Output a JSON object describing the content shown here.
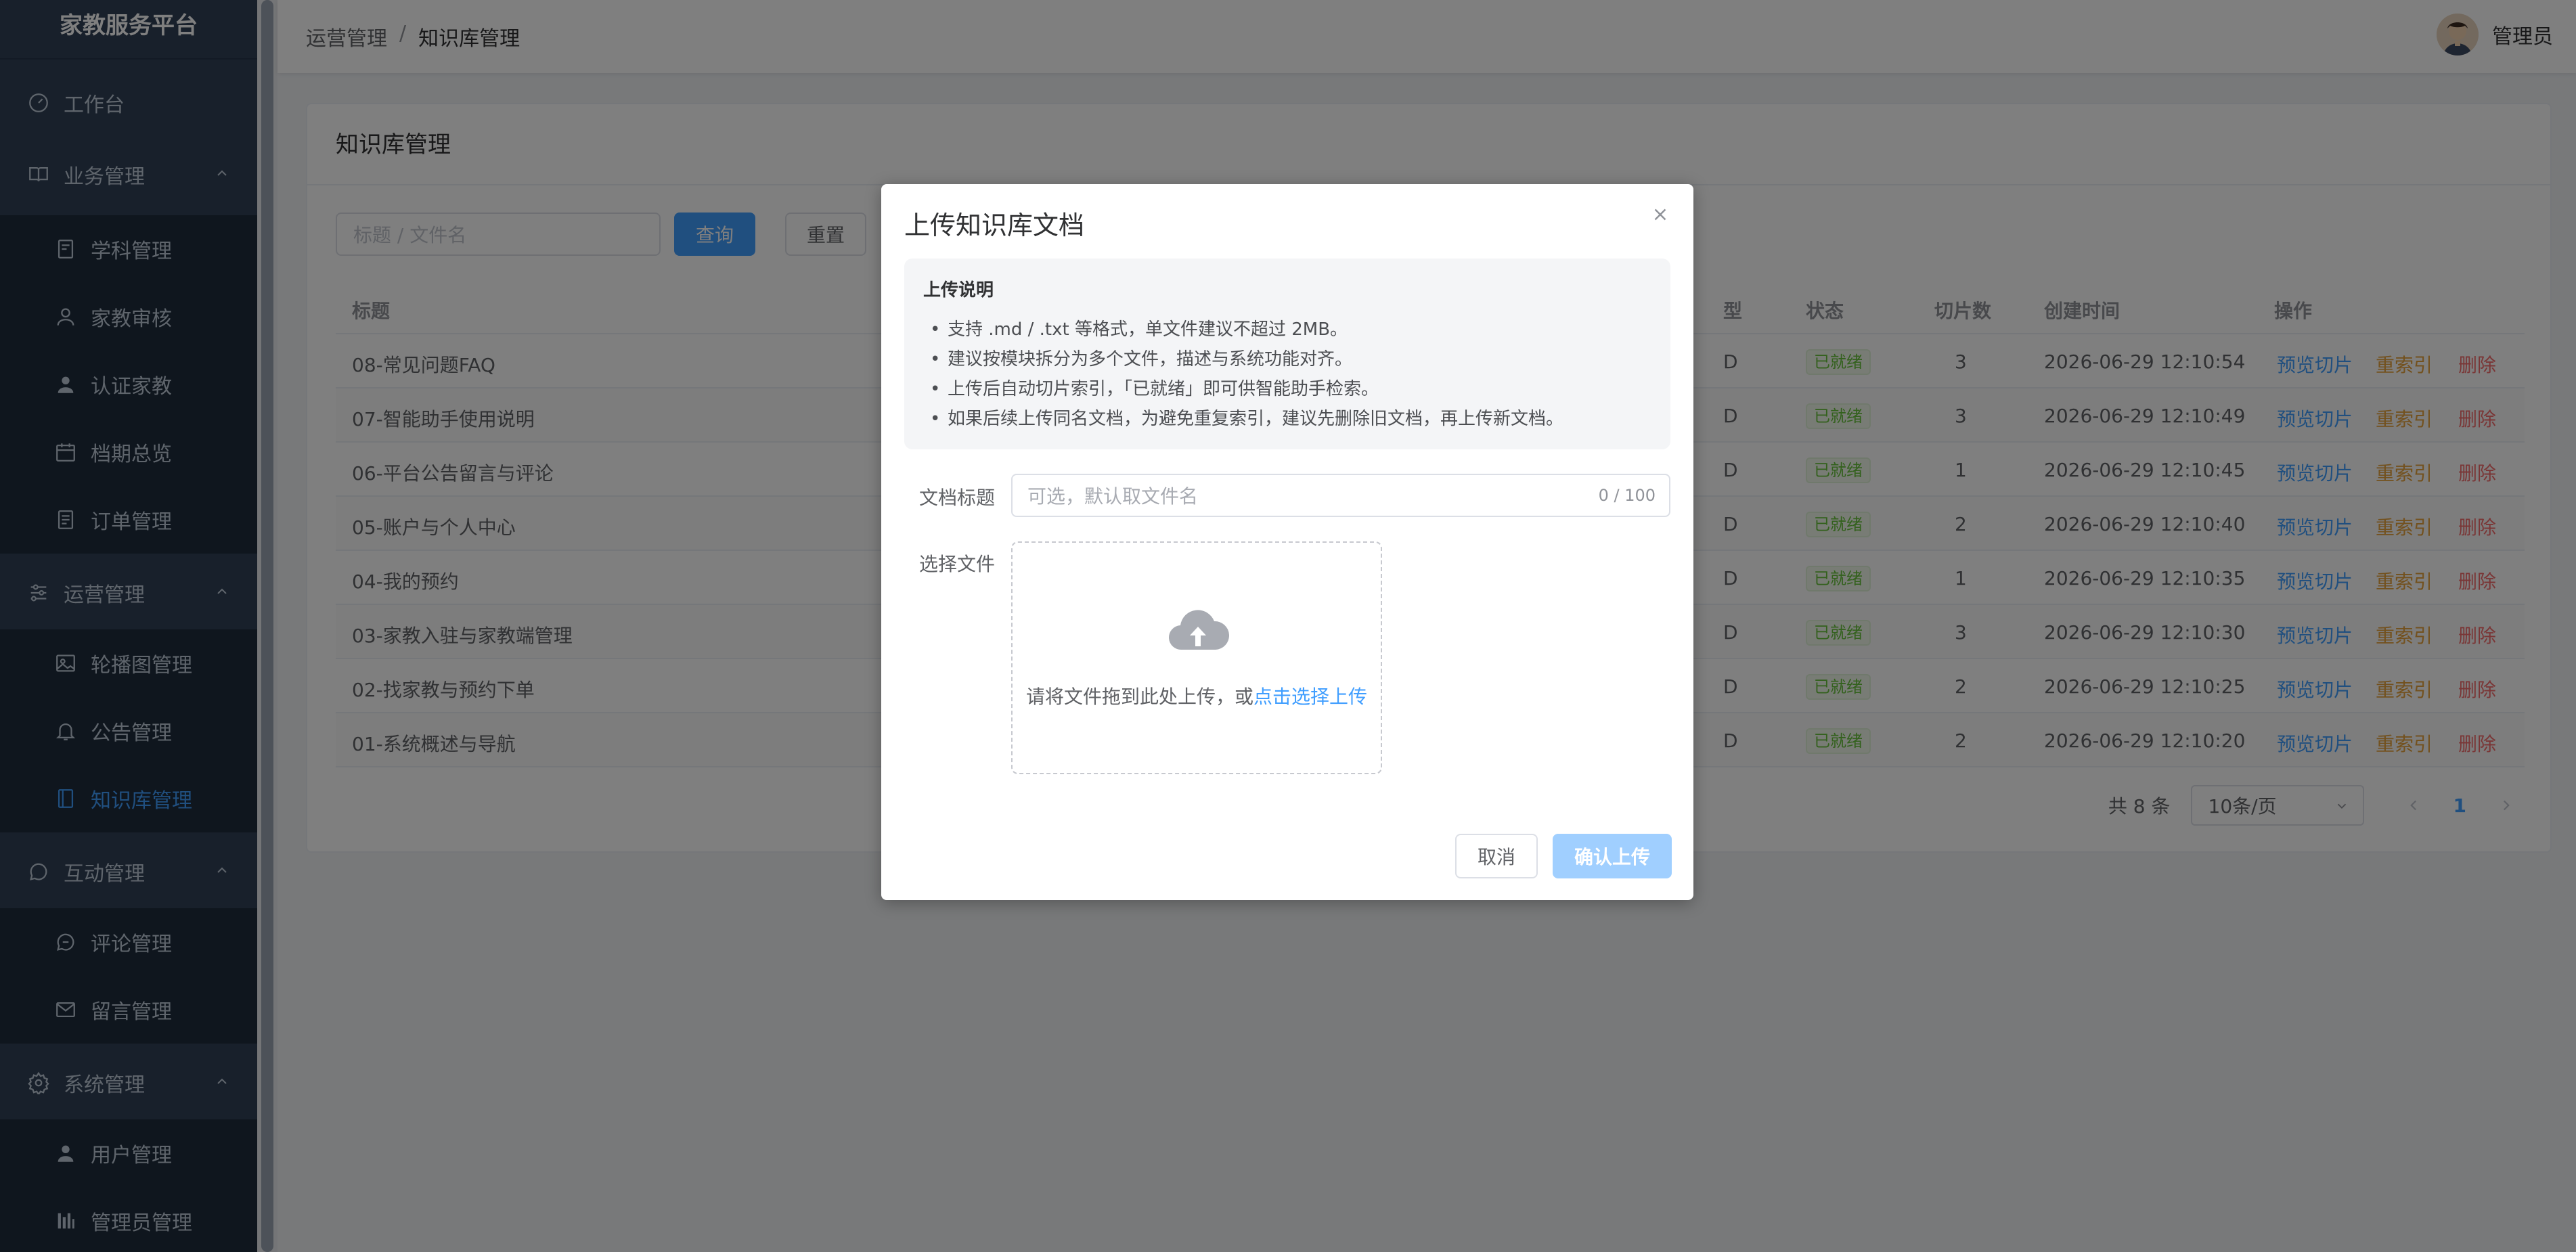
{
  "app": {
    "title": "家教服务平台"
  },
  "sidebar": {
    "items": [
      {
        "label": "工作台",
        "icon": "dashboard-icon"
      },
      {
        "label": "业务管理",
        "icon": "book-icon",
        "expanded": true
      },
      {
        "label": "学科管理",
        "icon": "document-icon"
      },
      {
        "label": "家教审核",
        "icon": "user-icon"
      },
      {
        "label": "认证家教",
        "icon": "user-filled-icon"
      },
      {
        "label": "档期总览",
        "icon": "calendar-icon"
      },
      {
        "label": "订单管理",
        "icon": "document-icon"
      },
      {
        "label": "运营管理",
        "icon": "sliders-icon",
        "expanded": true
      },
      {
        "label": "轮播图管理",
        "icon": "picture-icon"
      },
      {
        "label": "公告管理",
        "icon": "bell-icon"
      },
      {
        "label": "知识库管理",
        "icon": "notebook-icon",
        "active": true
      },
      {
        "label": "互动管理",
        "icon": "chat-icon",
        "expanded": true
      },
      {
        "label": "评论管理",
        "icon": "chat-icon"
      },
      {
        "label": "留言管理",
        "icon": "message-icon"
      },
      {
        "label": "系统管理",
        "icon": "gear-icon",
        "expanded": true
      },
      {
        "label": "用户管理",
        "icon": "user-filled-icon"
      },
      {
        "label": "管理员管理",
        "icon": "histogram-icon"
      }
    ]
  },
  "header": {
    "breadcrumb": [
      "运营管理",
      "知识库管理"
    ],
    "separator": "/",
    "user_name": "管理员"
  },
  "card": {
    "title": "知识库管理",
    "search_placeholder": "标题 / 文件名",
    "search_button": "查询",
    "reset_button": "重置"
  },
  "table": {
    "columns": [
      "标题",
      "型",
      "状态",
      "切片数",
      "创建时间",
      "操作"
    ],
    "rows": [
      {
        "title": "08-常见问题FAQ",
        "type_tail": "D",
        "status": "已就绪",
        "chunks": "3",
        "created": "2026-06-29 12:10:54"
      },
      {
        "title": "07-智能助手使用说明",
        "type_tail": "D",
        "status": "已就绪",
        "chunks": "3",
        "created": "2026-06-29 12:10:49"
      },
      {
        "title": "06-平台公告留言与评论",
        "type_tail": "D",
        "status": "已就绪",
        "chunks": "1",
        "created": "2026-06-29 12:10:45"
      },
      {
        "title": "05-账户与个人中心",
        "type_tail": "D",
        "status": "已就绪",
        "chunks": "2",
        "created": "2026-06-29 12:10:40"
      },
      {
        "title": "04-我的预约",
        "type_tail": "D",
        "status": "已就绪",
        "chunks": "1",
        "created": "2026-06-29 12:10:35"
      },
      {
        "title": "03-家教入驻与家教端管理",
        "type_tail": "D",
        "status": "已就绪",
        "chunks": "3",
        "created": "2026-06-29 12:10:30"
      },
      {
        "title": "02-找家教与预约下单",
        "type_tail": "D",
        "status": "已就绪",
        "chunks": "2",
        "created": "2026-06-29 12:10:25"
      },
      {
        "title": "01-系统概述与导航",
        "type_tail": "D",
        "status": "已就绪",
        "chunks": "2",
        "created": "2026-06-29 12:10:20"
      }
    ],
    "actions": {
      "preview": "预览切片",
      "reindex": "重索引",
      "delete": "删除"
    }
  },
  "pagination": {
    "total": "共 8 条",
    "page_size": "10条/页",
    "current_page": "1"
  },
  "dialog": {
    "title": "上传知识库文档",
    "notice_title": "上传说明",
    "notice_lines": [
      "支持 .md / .txt 等格式，单文件建议不超过 2MB。",
      "建议按模块拆分为多个文件，描述与系统功能对齐。",
      "上传后自动切片索引，「已就绪」即可供智能助手检索。",
      "如果后续上传同名文档，为避免重复索引，建议先删除旧文档，再上传新文档。"
    ],
    "title_label": "文档标题",
    "title_placeholder": "可选，默认取文件名",
    "title_count": "0 / 100",
    "file_label": "选择文件",
    "upload_text": "请将文件拖到此处上传，或",
    "upload_link": "点击选择上传",
    "cancel_button": "取消",
    "confirm_button": "确认上传"
  },
  "colors": {
    "sidebar_bg": "#304156",
    "primary": "#409eff",
    "success": "#67c23a",
    "warning": "#e6a23c",
    "danger": "#f56c6c"
  }
}
